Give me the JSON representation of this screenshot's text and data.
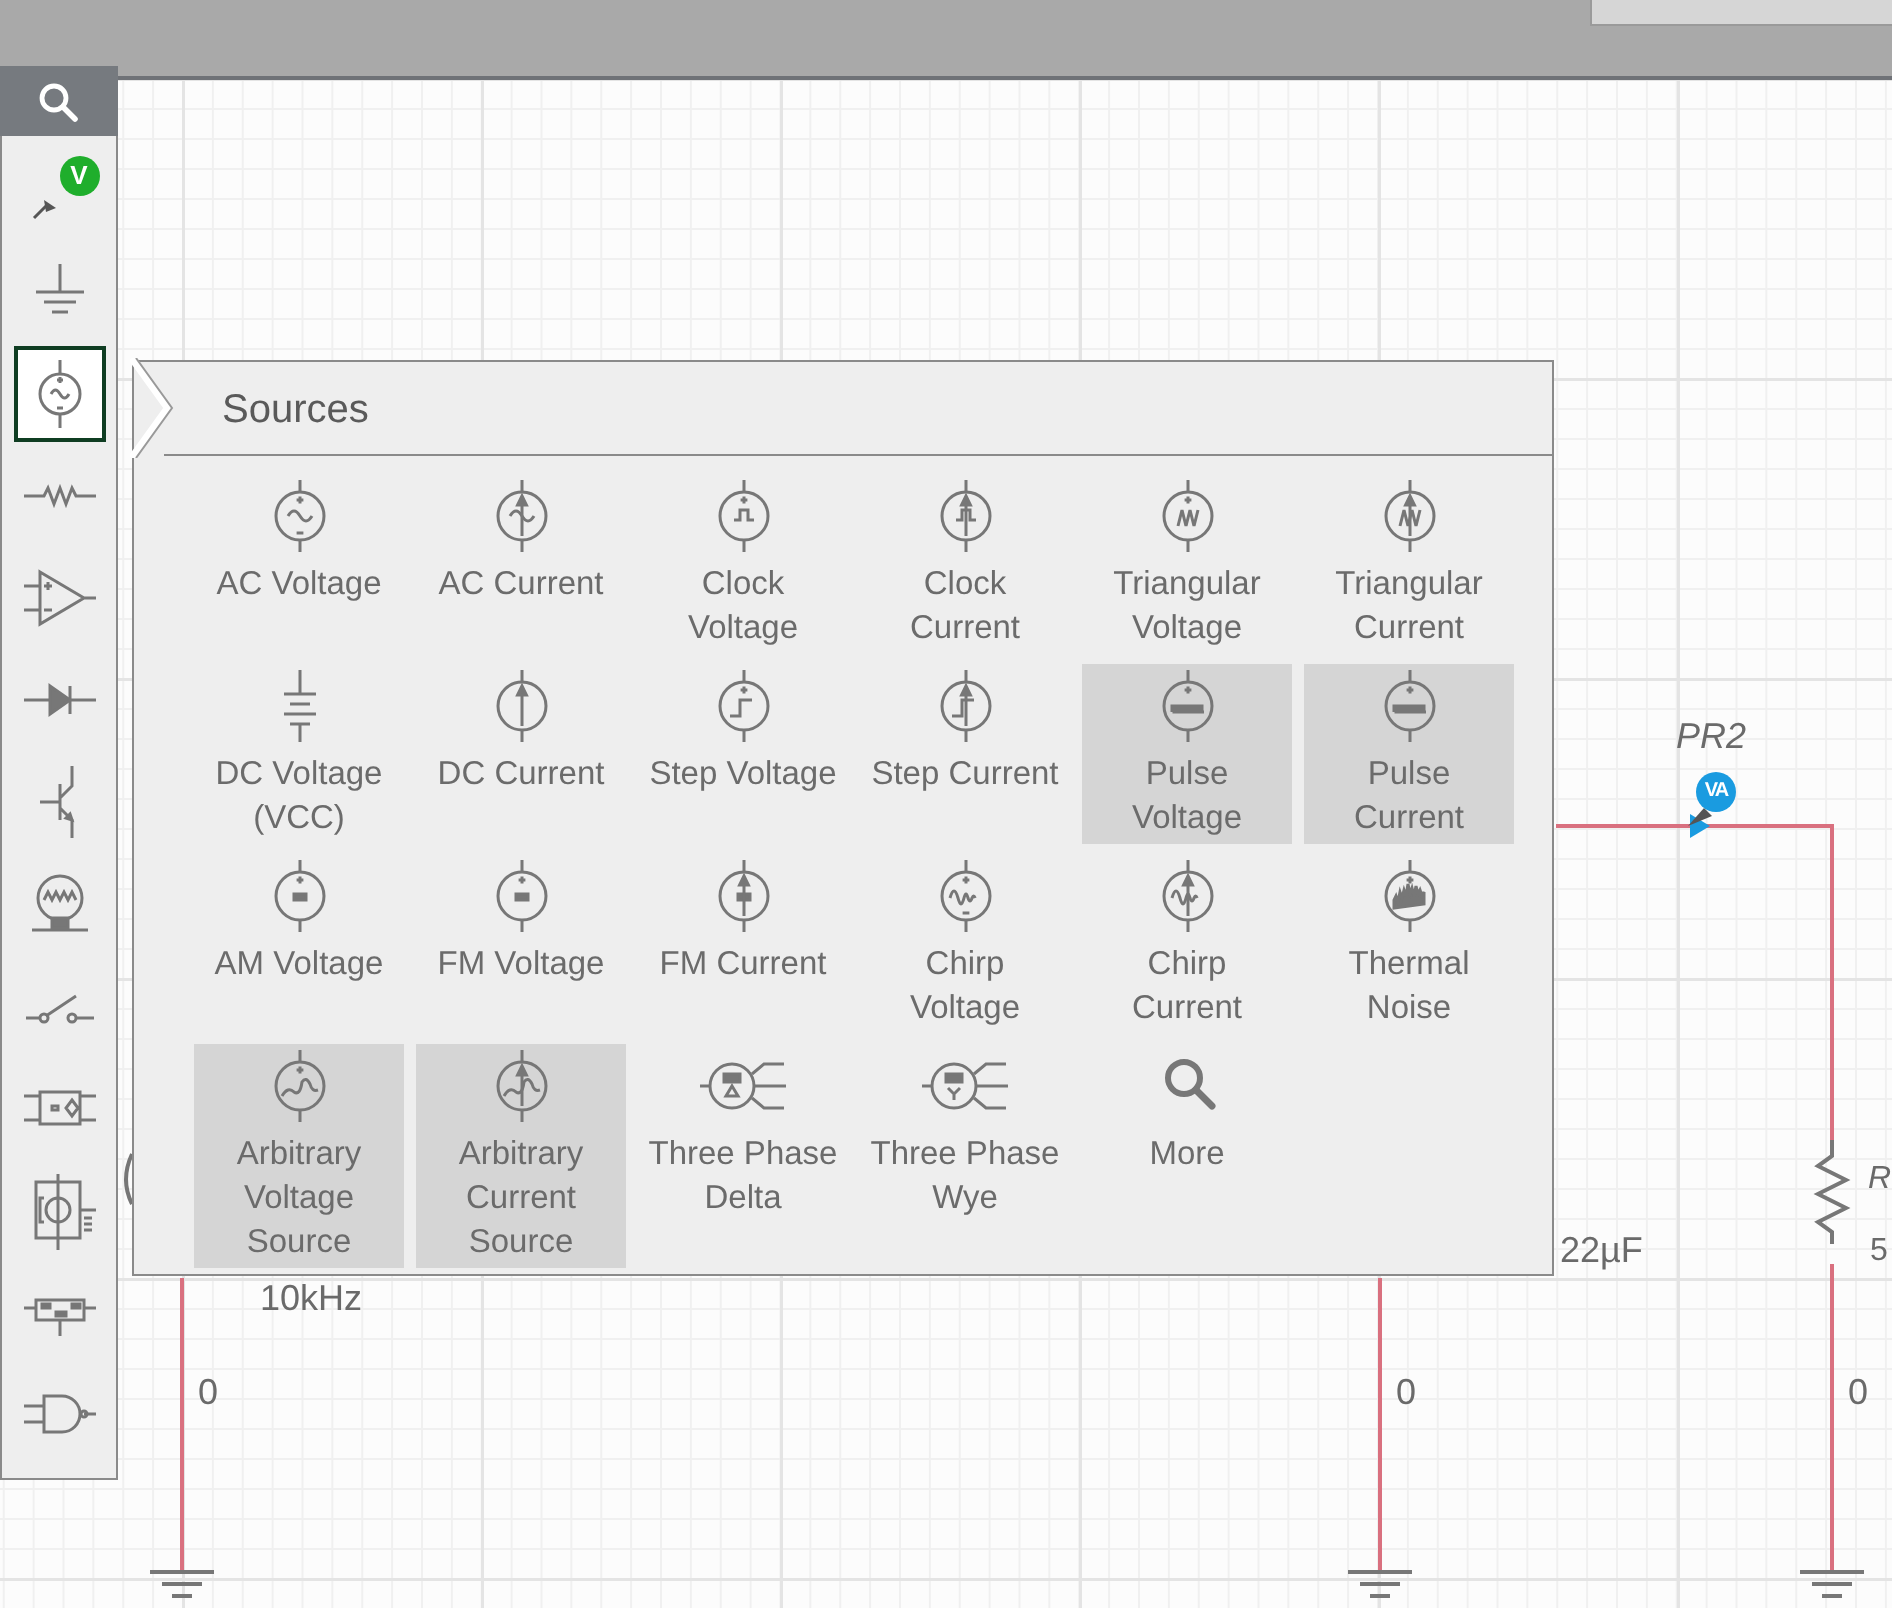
{
  "toolbar": {
    "items": [
      {
        "kind": "probe",
        "badge": "V",
        "selected": false
      },
      {
        "kind": "ground",
        "selected": false
      },
      {
        "kind": "source",
        "selected": true
      },
      {
        "kind": "resistor",
        "selected": false
      },
      {
        "kind": "opamp",
        "selected": false
      },
      {
        "kind": "diode",
        "selected": false
      },
      {
        "kind": "transistor",
        "selected": false
      },
      {
        "kind": "lamp",
        "selected": false
      },
      {
        "kind": "switch",
        "selected": false
      },
      {
        "kind": "optocoupler",
        "selected": false
      },
      {
        "kind": "module",
        "selected": false
      },
      {
        "kind": "chip",
        "selected": false
      },
      {
        "kind": "gate",
        "selected": false
      }
    ]
  },
  "sources_panel": {
    "title": "Sources",
    "items": [
      {
        "kind": "ac-voltage",
        "label": "AC Voltage",
        "highlighted": false
      },
      {
        "kind": "ac-current",
        "label": "AC Current",
        "highlighted": false
      },
      {
        "kind": "clock-voltage",
        "label": "Clock Voltage",
        "highlighted": false
      },
      {
        "kind": "clock-current",
        "label": "Clock Current",
        "highlighted": false
      },
      {
        "kind": "triangular-voltage",
        "label": "Triangular Voltage",
        "highlighted": false
      },
      {
        "kind": "triangular-current",
        "label": "Triangular Current",
        "highlighted": false
      },
      {
        "kind": "dc-voltage",
        "label": "DC Voltage (VCC)",
        "highlighted": false
      },
      {
        "kind": "dc-current",
        "label": "DC Current",
        "highlighted": false
      },
      {
        "kind": "step-voltage",
        "label": "Step Voltage",
        "highlighted": false
      },
      {
        "kind": "step-current",
        "label": "Step Current",
        "highlighted": false
      },
      {
        "kind": "pulse-voltage",
        "label": "Pulse Voltage",
        "highlighted": true
      },
      {
        "kind": "pulse-current",
        "label": "Pulse Current",
        "highlighted": true
      },
      {
        "kind": "am-voltage",
        "label": "AM Voltage",
        "highlighted": false
      },
      {
        "kind": "fm-voltage",
        "label": "FM Voltage",
        "highlighted": false
      },
      {
        "kind": "fm-current",
        "label": "FM Current",
        "highlighted": false
      },
      {
        "kind": "chirp-voltage",
        "label": "Chirp Voltage",
        "highlighted": false
      },
      {
        "kind": "chirp-current",
        "label": "Chirp Current",
        "highlighted": false
      },
      {
        "kind": "thermal-noise",
        "label": "Thermal Noise",
        "highlighted": false
      },
      {
        "kind": "arbitrary-voltage",
        "label": "Arbitrary Voltage Source",
        "highlighted": true
      },
      {
        "kind": "arbitrary-current",
        "label": "Arbitrary Current Source",
        "highlighted": true
      },
      {
        "kind": "three-phase-delta",
        "label": "Three Phase Delta",
        "highlighted": false
      },
      {
        "kind": "three-phase-wye",
        "label": "Three Phase Wye",
        "highlighted": false
      },
      {
        "kind": "more",
        "label": "More",
        "highlighted": false
      }
    ]
  },
  "schematic": {
    "source_frequency": "10kHz",
    "capacitor_value": "22µF",
    "resistor_label": "R",
    "resistor_value": "5",
    "node_labels": [
      "0",
      "0",
      "0"
    ],
    "probe": {
      "label": "PR2",
      "badge": "VA"
    }
  }
}
